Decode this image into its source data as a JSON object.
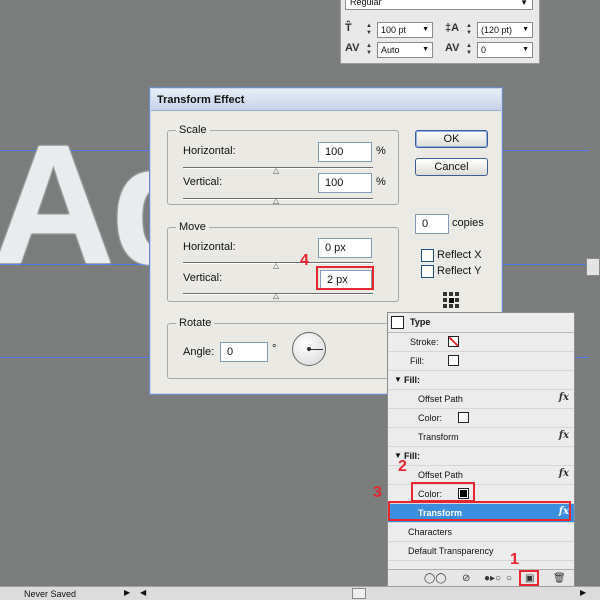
{
  "canvas": {
    "text": "Ad"
  },
  "character_panel": {
    "font_style": "Regular",
    "font_size": "100 pt",
    "leading": "(120 pt)",
    "kerning": "Auto",
    "tracking": "0",
    "icons": [
      "font-size-icon",
      "leading-icon",
      "kerning-icon",
      "tracking-icon"
    ]
  },
  "dialog": {
    "title": "Transform Effect",
    "scale": {
      "title": "Scale",
      "horizontal_label": "Horizontal:",
      "horizontal_value": "100",
      "horizontal_unit": "%",
      "vertical_label": "Vertical:",
      "vertical_value": "100",
      "vertical_unit": "%"
    },
    "move": {
      "title": "Move",
      "horizontal_label": "Horizontal:",
      "horizontal_value": "0 px",
      "vertical_label": "Vertical:",
      "vertical_value": "2 px"
    },
    "rotate": {
      "title": "Rotate",
      "angle_label": "Angle:",
      "angle_value": "0",
      "angle_unit": "°"
    },
    "ok_label": "OK",
    "cancel_label": "Cancel",
    "copies_value": "0",
    "copies_label": "copies",
    "reflect_x_label": "Reflect X",
    "reflect_y_label": "Reflect Y"
  },
  "appearance_panel": {
    "header": "Type",
    "stroke_label": "Stroke:",
    "fill_label": "Fill:",
    "fill1": {
      "label": "Fill:",
      "offset_path": "Offset Path",
      "color_label": "Color:",
      "transform": "Transform"
    },
    "fill2": {
      "label": "Fill:",
      "offset_path": "Offset Path",
      "color_label": "Color:",
      "transform": "Transform"
    },
    "characters": "Characters",
    "default_transparency": "Default Transparency",
    "fx": "fx",
    "colors": {
      "selected_row": "#3b8fde",
      "fill2_color": "#000000"
    }
  },
  "status_bar": {
    "text": "Never Saved"
  },
  "annotations": {
    "step1": "1",
    "step2": "2",
    "step3": "3",
    "step4": "4",
    "color": "#e8262d"
  }
}
